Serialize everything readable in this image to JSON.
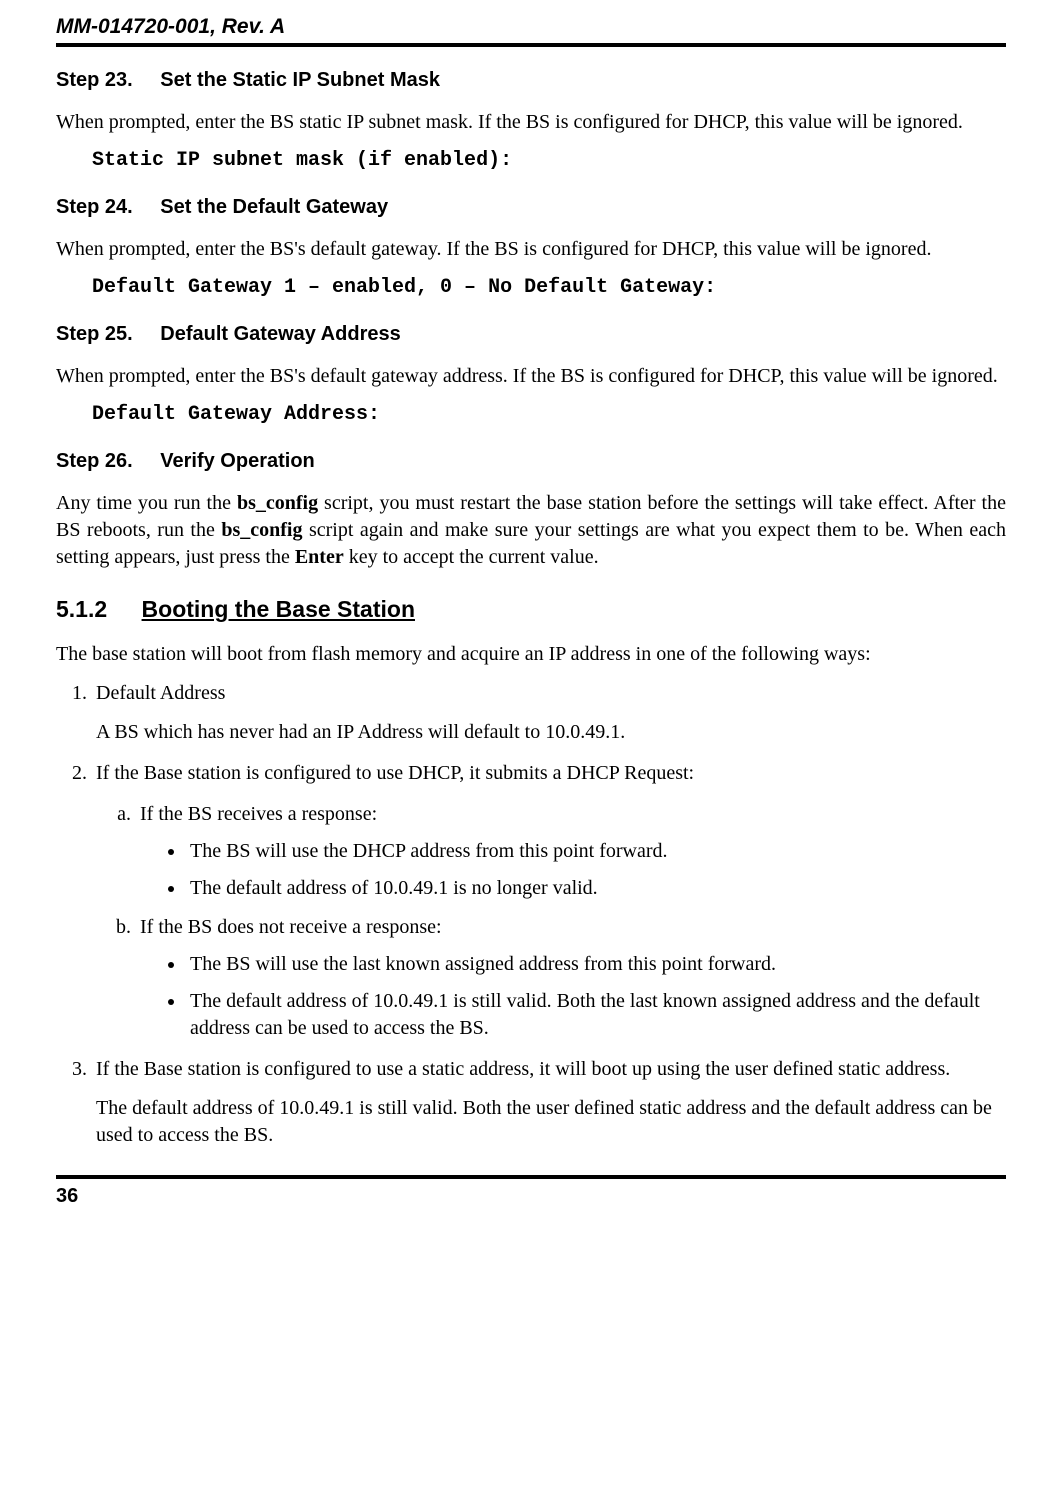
{
  "header": "MM-014720-001, Rev. A",
  "page_number": "36",
  "steps": [
    {
      "label": "Step 23.",
      "title": "Set the Static IP Subnet Mask",
      "body": "When prompted, enter the BS static IP subnet mask.  If the BS is configured for DHCP, this value will be ignored.",
      "code": "Static IP subnet mask (if enabled):"
    },
    {
      "label": "Step 24.",
      "title": "Set the Default Gateway",
      "body": "When prompted, enter the BS's default gateway.  If the BS is configured for DHCP, this value will be ignored.",
      "code": "Default Gateway 1 – enabled, 0 – No Default Gateway:"
    },
    {
      "label": "Step 25.",
      "title": "Default Gateway Address",
      "body": "When prompted, enter the BS's default gateway address.  If the BS is configured for DHCP, this value will be ignored.",
      "code": "Default Gateway Address:"
    },
    {
      "label": "Step 26.",
      "title": "Verify Operation",
      "body_html": "Any time you run the <b class='term'>bs_config</b> script, you must restart the base station before the settings will take effect.  After the BS reboots, run the <b class='term'>bs_config</b> script again and make sure your settings are what you expect them to be.  When each setting appears, just press the <b class='term'>Enter</b> key to accept the current value."
    }
  ],
  "section": {
    "num": "5.1.2",
    "title": "Booting the Base Station",
    "intro": "The base station will boot from flash memory and acquire an IP address in one of the following ways:"
  },
  "list": {
    "item1": {
      "title": "Default Address",
      "body": "A BS which has never had an IP Address will default to 10.0.49.1."
    },
    "item2": {
      "title": "If the Base station is configured to use DHCP, it submits a DHCP Request:",
      "a": {
        "title": "If the BS receives a response:",
        "b1": "The BS will use the DHCP address from this point forward.",
        "b2": "The default address of 10.0.49.1 is no longer valid."
      },
      "b": {
        "title": "If the BS does not receive a response:",
        "b1": "The BS will use the last known assigned address from this point forward.",
        "b2": "The default address of 10.0.49.1 is still valid.  Both the last known assigned address and the default address can be used to access the BS."
      }
    },
    "item3": {
      "title": "If the Base station is configured to use a static address, it will boot up using the user defined static address.",
      "body": "The default address of 10.0.49.1 is still valid.  Both the user defined static address and the default address can be used to access the BS."
    }
  }
}
